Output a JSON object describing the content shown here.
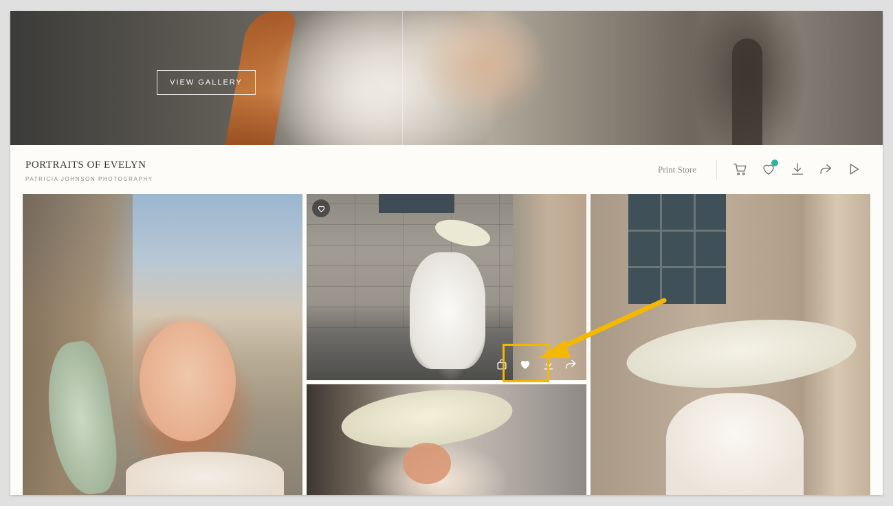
{
  "hero": {
    "view_gallery_label": "VIEW GALLERY"
  },
  "header": {
    "title": "PORTRAITS OF EVELYN",
    "subtitle": "PATRICIA JOHNSON PHOTOGRAPHY",
    "print_store_label": "Print Store",
    "icons": [
      "cart-icon",
      "heart-icon",
      "download-icon",
      "share-icon",
      "play-icon"
    ],
    "favorites_indicator_color": "#2bb3a3"
  },
  "photos": [
    {
      "name": "photo-portrait-freckles"
    },
    {
      "name": "photo-white-dress-hat",
      "overlay_icons": [
        "heart-icon",
        "cart-icon",
        "heart-icon",
        "download-icon",
        "share-icon"
      ]
    },
    {
      "name": "photo-hat-rooftop"
    },
    {
      "name": "photo-wide-brim-hat"
    }
  ],
  "annotation": {
    "color": "#f5b800"
  }
}
